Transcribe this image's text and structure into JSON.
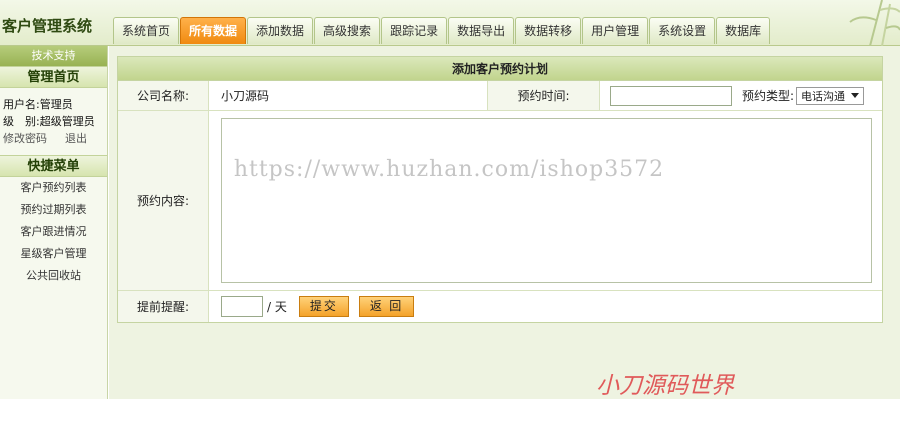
{
  "header": {
    "app_title": "客户管理系统",
    "tabs": [
      {
        "label": "系统首页"
      },
      {
        "label": "所有数据",
        "active": true
      },
      {
        "label": "添加数据"
      },
      {
        "label": "高级搜索"
      },
      {
        "label": "跟踪记录"
      },
      {
        "label": "数据导出"
      },
      {
        "label": "数据转移"
      },
      {
        "label": "用户管理"
      },
      {
        "label": "系统设置"
      },
      {
        "label": "数据库"
      }
    ]
  },
  "sidebar": {
    "support_label": "技术支持",
    "admin_home": "管理首页",
    "user": {
      "username_line": "用户名:管理员",
      "level_line": "级　别:超级管理员",
      "change_password": "修改密码",
      "logout": "退出"
    },
    "quick_menu_title": "快捷菜单",
    "quick_items": [
      {
        "label": "客户预约列表"
      },
      {
        "label": "预约过期列表"
      },
      {
        "label": "客户跟进情况"
      },
      {
        "label": "星级客户管理"
      },
      {
        "label": "公共回收站"
      }
    ]
  },
  "form": {
    "title": "添加客户预约计划",
    "company_label": "公司名称:",
    "company_value": "小刀源码",
    "time_label": "预约时间:",
    "time_value": "",
    "type_label": "预约类型:",
    "type_selected": "电话沟通",
    "content_label": "预约内容:",
    "content_value": "",
    "remind_label": "提前提醒:",
    "remind_value": "",
    "remind_unit": "/ 天",
    "submit_label": "提交",
    "back_label": "返 回"
  },
  "watermark": "https://www.huzhan.com/ishop3572",
  "signature": "小刀源码世界",
  "colors": {
    "accent_tab": "#f08a10",
    "header_green": "#e3eccb",
    "button_orange": "#f4a22a"
  }
}
